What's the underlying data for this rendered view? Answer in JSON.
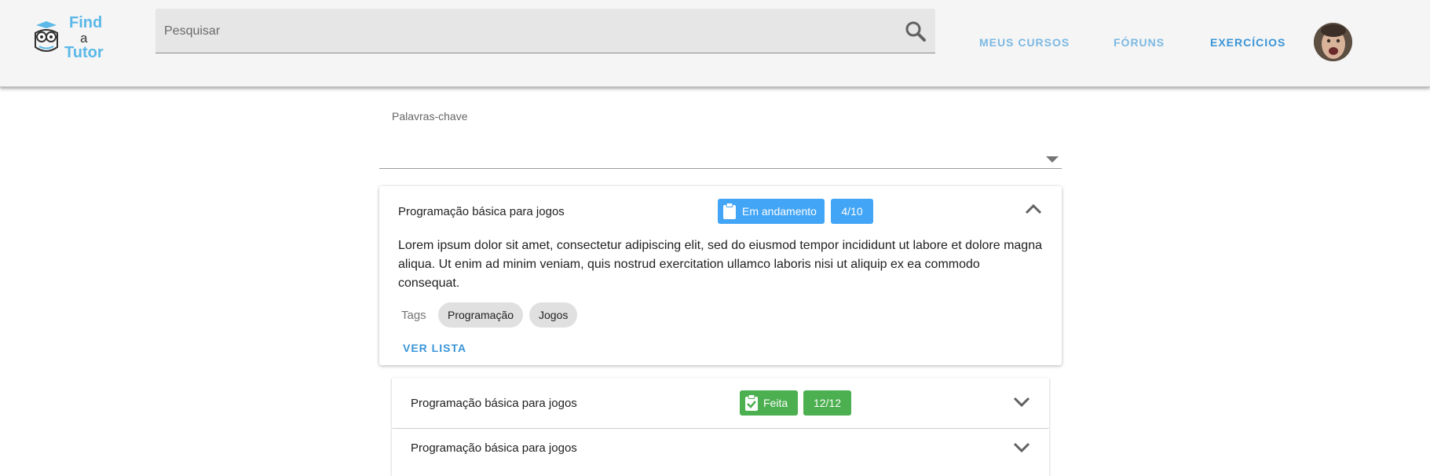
{
  "header": {
    "logo": {
      "line1": "Find",
      "line2": "a",
      "line3": "Tutor"
    },
    "search": {
      "placeholder": "Pesquisar"
    },
    "nav": [
      {
        "label": "MEUS CURSOS"
      },
      {
        "label": "FÓRUNS"
      },
      {
        "label": "EXERCÍCIOS"
      }
    ]
  },
  "filter": {
    "keywords_label": "Palavras-chave"
  },
  "lists": [
    {
      "title": "Programação básica para jogos",
      "status": "Em andamento",
      "progress": "4/10",
      "expanded": true,
      "description": "Lorem ipsum dolor sit amet, consectetur adipiscing elit, sed do eiusmod tempor incididunt ut labore et dolore magna aliqua. Ut enim ad minim veniam, quis nostrud exercitation ullamco laboris nisi ut aliquip ex ea commodo consequat.",
      "tags_label": "Tags",
      "tags": [
        "Programação",
        "Jogos"
      ],
      "action": "VER LISTA"
    },
    {
      "title": "Programação básica para jogos",
      "status": "Feita",
      "progress": "12/12",
      "expanded": false
    },
    {
      "title": "Programação básica para jogos",
      "expanded": false
    }
  ],
  "colors": {
    "accent": "#3a95d8",
    "in_progress": "#42a5f5",
    "done": "#4caf50"
  }
}
